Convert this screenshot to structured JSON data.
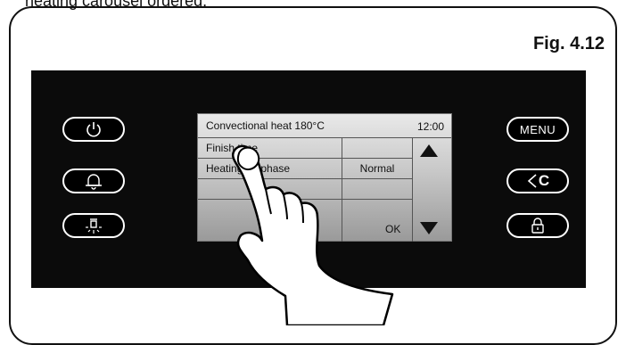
{
  "caption_fragment": "heating carousel ordered.",
  "figure_label": "Fig. 4.12",
  "left_buttons": [
    {
      "name": "power-button",
      "icon": "power-icon"
    },
    {
      "name": "timer-button",
      "icon": "bell-icon"
    },
    {
      "name": "light-button",
      "icon": "lamp-icon"
    }
  ],
  "right_buttons": {
    "menu_label": "MENU",
    "back_clear_label": "C",
    "lock_icon": "padlock-icon"
  },
  "screen": {
    "title": "Convectional heat 180°C",
    "clock": "12:00",
    "rows": [
      {
        "label": "Finish time",
        "value": ""
      },
      {
        "label": "Heating up phase",
        "value": "Normal"
      },
      {
        "label": "",
        "value": ""
      }
    ],
    "ok_label": "OK",
    "scroll_up_icon": "triangle-up-icon",
    "scroll_down_icon": "triangle-down-icon"
  },
  "colors": {
    "panel": "#0b0b0b",
    "button_border": "#ffffff",
    "screen_top": "#e9e9e9",
    "screen_bottom": "#9a9a9a"
  }
}
